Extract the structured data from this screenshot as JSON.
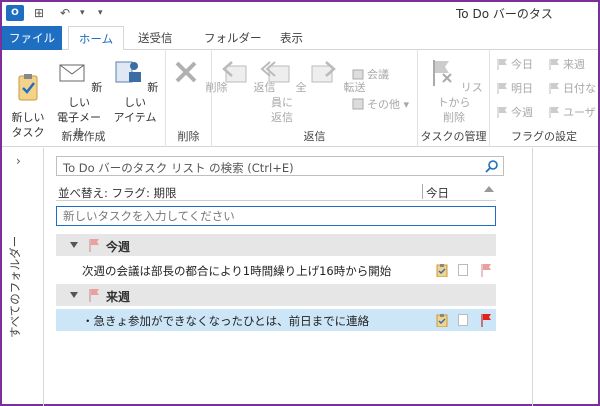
{
  "window": {
    "title": "To Do バーのタス"
  },
  "tabs": [
    {
      "label": "ファイル"
    },
    {
      "label": "ホーム"
    },
    {
      "label": "送受信"
    },
    {
      "label": "フォルダー"
    },
    {
      "label": "表示"
    }
  ],
  "ribbon": {
    "new_group": {
      "label": "新規作成",
      "new_task": "新しい\nタスク",
      "new_mail": "新しい\n電子メール",
      "new_item": "新しい\nアイテム"
    },
    "delete_group": {
      "label": "削除",
      "delete": "削除"
    },
    "reply_group": {
      "label": "返信",
      "reply": "返信",
      "reply_all": "全員に\n返信",
      "forward": "転送",
      "meeting": "会議",
      "more": "その他"
    },
    "manage_group": {
      "label": "タスクの管理",
      "remove_from_list": "リストから\n削除"
    },
    "flag_group": {
      "label": "フラグの設定",
      "today": "今日",
      "tomorrow": "明日",
      "this_week": "今週",
      "next_week": "来週",
      "no_date": "日付な",
      "custom": "ユーザ"
    }
  },
  "left_pane": {
    "label": "すべてのフォルダー"
  },
  "search": {
    "placeholder": "To Do バーのタスク リスト の検索 (Ctrl+E)"
  },
  "sort": {
    "label": "並べ替え: フラグ: 期限",
    "column": "今日"
  },
  "new_task": {
    "placeholder": "新しいタスクを入力してください"
  },
  "groups": [
    {
      "name": "今週",
      "tasks": [
        {
          "subject": "次週の会議は部長の都合により1時間繰り上げ16時から開始",
          "flag_color": "#e8a0a0",
          "selected": false
        }
      ]
    },
    {
      "name": "来週",
      "tasks": [
        {
          "subject": "・急きょ参加ができなくなったひとは、前日までに連絡",
          "flag_color": "#e0201c",
          "selected": true
        }
      ]
    }
  ],
  "colors": {
    "accent": "#1e6fc2",
    "selection": "#cde6f7",
    "frame": "#7b2f9a"
  }
}
